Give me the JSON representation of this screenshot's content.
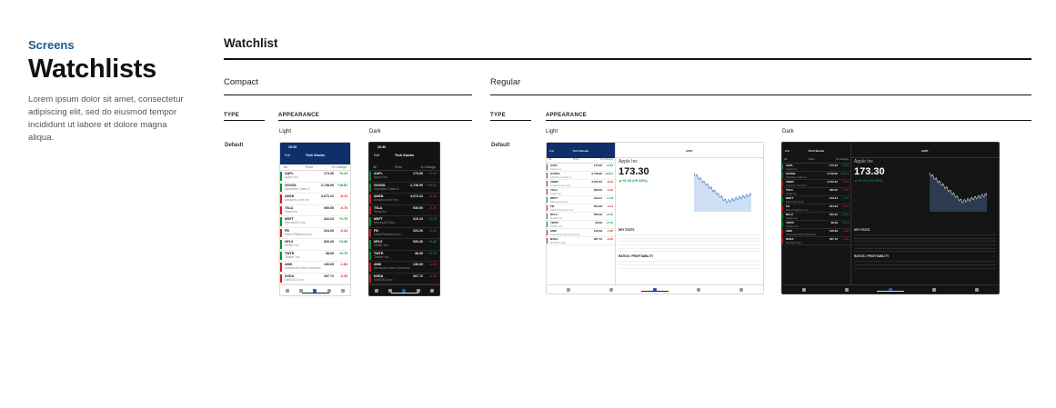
{
  "header": {
    "eyebrow": "Screens",
    "title": "Watchlists",
    "description": "Lorem ipsum dolor sit amet, consectetur adipiscing elit, sed do eiusmod tempor incididunt ut labore et dolore magna aliqua."
  },
  "section": {
    "title": "Watchlist",
    "compact": {
      "title": "Compact",
      "type_head": "TYPE",
      "appearance_head": "APPEARANCE",
      "light_label": "Light",
      "dark_label": "Dark",
      "row_label": "Default"
    },
    "regular": {
      "title": "Regular",
      "type_head": "TYPE",
      "appearance_head": "APPEARANCE",
      "light_label": "Light",
      "dark_label": "Dark",
      "row_label": "Default"
    }
  },
  "mock": {
    "status_time": "10:30",
    "list_title": "Tech Stocks",
    "edit": "Edit",
    "col_sym": "All",
    "col_price": "Price",
    "col_change": "% Change",
    "detail_title": "AAPL",
    "detail_company": "Apple Inc",
    "detail_price": "173.30",
    "detail_change": "▲+0.23 (+0.13%)",
    "key_stats": "KEY STATS",
    "ratios": "RATIOS / PROFITABILITY",
    "stocks": [
      {
        "sym": "AAPL",
        "name": "Apple Inc",
        "price": "173.30",
        "change": "+0.23",
        "up": true
      },
      {
        "sym": "GOOGL",
        "name": "Alphabet Class A",
        "price": "2,748.90",
        "change": "+18.51",
        "up": true
      },
      {
        "sym": "AMZN",
        "name": "Amazon.com Inc",
        "price": "3,072.22",
        "change": "-8.13",
        "up": false
      },
      {
        "sym": "TSLA",
        "name": "Tesla Inc",
        "price": "930.00",
        "change": "-0.76",
        "up": false
      },
      {
        "sym": "MSFT",
        "name": "Microsoft Corp",
        "price": "310.24",
        "change": "+1.73",
        "up": true
      },
      {
        "sym": "FB",
        "name": "Meta Platforms Inc",
        "price": "224.26",
        "change": "-0.24",
        "up": false
      },
      {
        "sym": "NFLX",
        "name": "Netflix Inc",
        "price": "520.26",
        "change": "+3.46",
        "up": true
      },
      {
        "sym": "TWTR",
        "name": "Twitter Inc",
        "price": "38.09",
        "change": "+0.79",
        "up": true
      },
      {
        "sym": "AMD",
        "name": "Advanced Micro Devices",
        "price": "136.69",
        "change": "-1.66",
        "up": false
      },
      {
        "sym": "NVDA",
        "name": "NVIDIA Corp",
        "price": "297.72",
        "change": "-2.20",
        "up": false
      }
    ],
    "colors": {
      "up": "#0a8a3a",
      "down": "#d0201a",
      "navy": "#0f2f6b",
      "accent": "#1d5a8c"
    }
  }
}
